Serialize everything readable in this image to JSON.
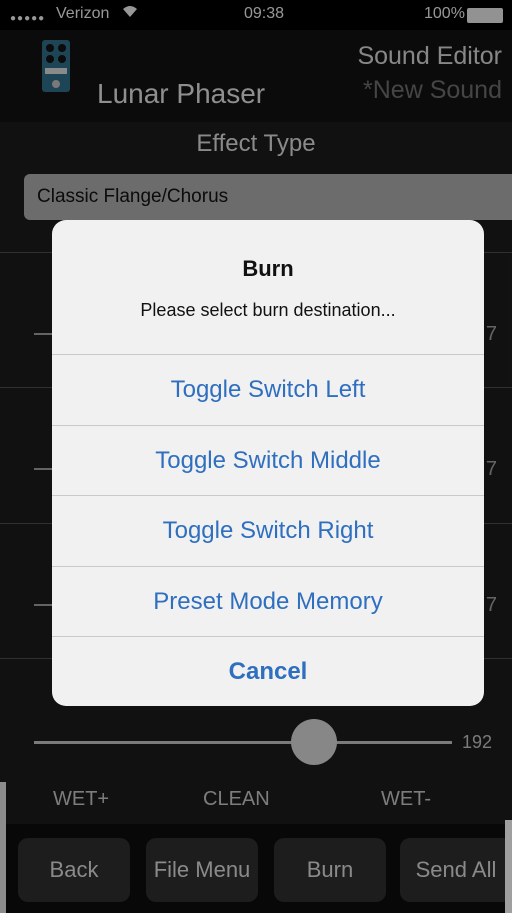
{
  "status_bar": {
    "signal": "●●●●●",
    "carrier": "Verizon",
    "wifi_icon": "wifi-icon",
    "time": "09:38",
    "battery": "100%"
  },
  "header": {
    "device_name": "Lunar Phaser",
    "editor_title": "Sound Editor",
    "sound_name": "*New Sound",
    "pedal_icon": "pedal-icon"
  },
  "effect": {
    "label": "Effect Type",
    "selected": "Classic Flange/Chorus"
  },
  "background_rows": {
    "value_glyph": "7"
  },
  "mix": {
    "value": "192",
    "slider_fraction": 0.67,
    "left_label": "WET+",
    "center_label": "CLEAN",
    "right_label": "WET-"
  },
  "toolbar": {
    "back": "Back",
    "file_menu": "File Menu",
    "burn": "Burn",
    "send_all": "Send All"
  },
  "dialog": {
    "title": "Burn",
    "message": "Please select burn destination...",
    "options": [
      "Toggle Switch Left",
      "Toggle Switch Middle",
      "Toggle Switch Right",
      "Preset Mode Memory"
    ],
    "cancel": "Cancel",
    "button_color": "#2f6fc0"
  }
}
